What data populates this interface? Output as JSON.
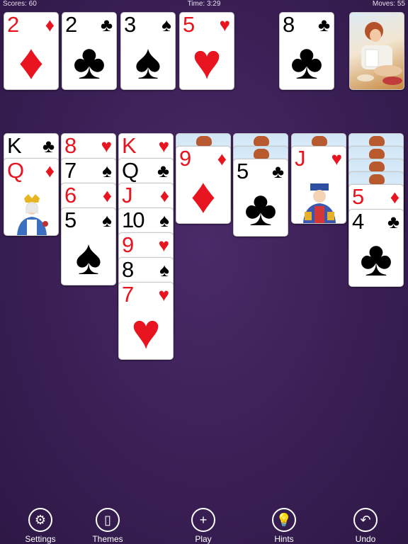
{
  "status": {
    "score": "Scores: 60",
    "time": "Time: 3:29",
    "moves": "Moves: 55"
  },
  "foundations": [
    {
      "rank": "2",
      "suit": "♦",
      "color": "red"
    },
    {
      "rank": "2",
      "suit": "♣",
      "color": "blk"
    },
    {
      "rank": "3",
      "suit": "♠",
      "color": "blk"
    },
    {
      "rank": "5",
      "suit": "♥",
      "color": "red"
    }
  ],
  "waste": {
    "rank": "8",
    "suit": "♣",
    "color": "blk"
  },
  "tableau": [
    [
      {
        "rank": "K",
        "suit": "♣",
        "color": "blk"
      },
      {
        "rank": "Q",
        "suit": "♦",
        "color": "red",
        "face": "queen"
      }
    ],
    [
      {
        "rank": "8",
        "suit": "♥",
        "color": "red"
      },
      {
        "rank": "7",
        "suit": "♠",
        "color": "blk"
      },
      {
        "rank": "6",
        "suit": "♦",
        "color": "red"
      },
      {
        "rank": "5",
        "suit": "♠",
        "color": "blk"
      }
    ],
    [
      {
        "rank": "K",
        "suit": "♥",
        "color": "red"
      },
      {
        "rank": "Q",
        "suit": "♣",
        "color": "blk"
      },
      {
        "rank": "J",
        "suit": "♦",
        "color": "red"
      },
      {
        "rank": "10",
        "suit": "♠",
        "color": "blk"
      },
      {
        "rank": "9",
        "suit": "♥",
        "color": "red"
      },
      {
        "rank": "8",
        "suit": "♠",
        "color": "blk"
      },
      {
        "rank": "7",
        "suit": "♥",
        "color": "red"
      }
    ],
    [
      {
        "back": true
      },
      {
        "rank": "9",
        "suit": "♦",
        "color": "red"
      }
    ],
    [
      {
        "back": true
      },
      {
        "back": true
      },
      {
        "rank": "5",
        "suit": "♣",
        "color": "blk"
      }
    ],
    [
      {
        "back": true
      },
      {
        "rank": "J",
        "suit": "♥",
        "color": "red",
        "face": "jack"
      }
    ],
    [
      {
        "back": true
      },
      {
        "back": true
      },
      {
        "back": true
      },
      {
        "back": true
      },
      {
        "rank": "5",
        "suit": "♦",
        "color": "red"
      },
      {
        "rank": "4",
        "suit": "♣",
        "color": "blk"
      }
    ]
  ],
  "toolbar": [
    {
      "label": "Settings",
      "icon": "gear-icon",
      "glyph": "⚙"
    },
    {
      "label": "Themes",
      "icon": "themes-icon",
      "glyph": "▯"
    },
    {
      "label": "Play",
      "icon": "plus-icon",
      "glyph": "+"
    },
    {
      "label": "Hints",
      "icon": "lightbulb-icon",
      "glyph": "💡"
    },
    {
      "label": "Undo",
      "icon": "undo-icon",
      "glyph": "↶"
    }
  ],
  "colors": {
    "background": "#3a1f55",
    "red": "#e8141f",
    "black": "#000000"
  }
}
